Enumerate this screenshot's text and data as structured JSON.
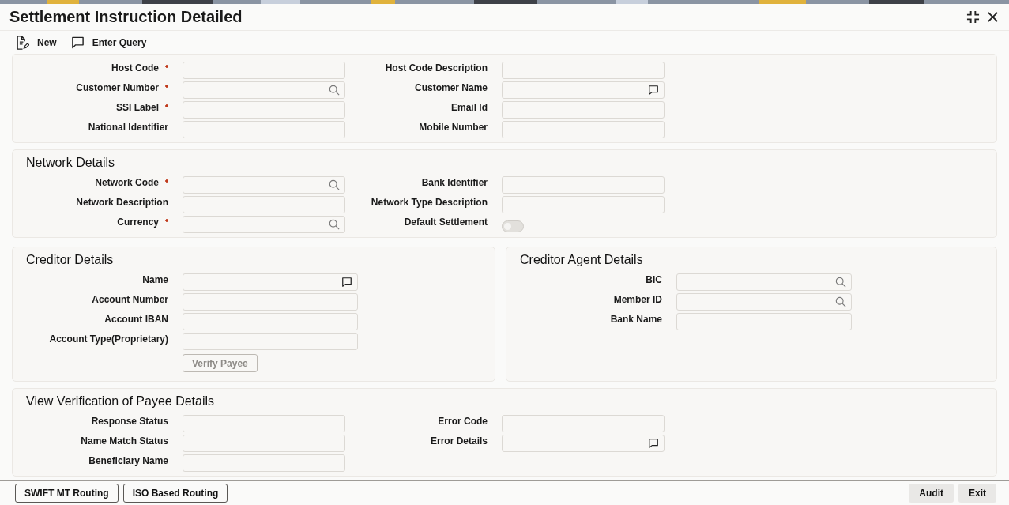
{
  "window": {
    "title": "Settlement Instruction Detailed"
  },
  "toolbar": [
    {
      "label": "New",
      "kind": "new"
    },
    {
      "label": "Enter Query",
      "kind": "query"
    }
  ],
  "sections": [
    {
      "wide": false,
      "columns": [
        {
          "fields": [
            {
              "label": "Host Code",
              "required": true,
              "kind": "plain"
            },
            {
              "label": "Customer Number",
              "required": true,
              "kind": "search"
            },
            {
              "label": "SSI Label",
              "required": true,
              "kind": "plain"
            },
            {
              "label": "National Identifier",
              "required": false,
              "kind": "plain"
            }
          ]
        },
        {
          "fields": [
            {
              "label": "Host Code Description",
              "required": false,
              "kind": "plain"
            },
            {
              "label": "Customer Name",
              "required": false,
              "kind": "comment"
            },
            {
              "label": "Email Id",
              "required": false,
              "kind": "plain"
            },
            {
              "label": "Mobile Number",
              "required": false,
              "kind": "plain"
            }
          ]
        }
      ]
    },
    {
      "title": "Network Details",
      "wide": false,
      "columns": [
        {
          "fields": [
            {
              "label": "Network Code",
              "required": true,
              "kind": "search"
            },
            {
              "label": "Network Description",
              "required": false,
              "kind": "plain"
            },
            {
              "label": "Currency",
              "required": true,
              "kind": "search"
            }
          ]
        },
        {
          "fields": [
            {
              "label": "Bank Identifier",
              "required": false,
              "kind": "plain"
            },
            {
              "label": "Network Type Description",
              "required": false,
              "kind": "plain"
            },
            {
              "label": "Default Settlement",
              "required": false,
              "kind": "toggle",
              "on": false
            }
          ]
        }
      ]
    },
    {
      "title": "Creditor Details",
      "wide": true,
      "columns": [
        {
          "fields": [
            {
              "label": "Name",
              "required": false,
              "kind": "comment"
            },
            {
              "label": "Account Number",
              "required": false,
              "kind": "plain"
            },
            {
              "label": "Account IBAN",
              "required": false,
              "kind": "plain"
            },
            {
              "label": "Account Type(Proprietary)",
              "required": false,
              "kind": "plain"
            },
            {
              "label": "Verify Payee",
              "kind": "button",
              "disabled": true
            }
          ]
        }
      ]
    },
    {
      "title": "Creditor Agent Details",
      "wide": true,
      "columns": [
        {
          "fields": [
            {
              "label": "BIC",
              "required": false,
              "kind": "search"
            },
            {
              "label": "Member ID",
              "required": false,
              "kind": "search"
            },
            {
              "label": "Bank Name",
              "required": false,
              "kind": "plain"
            }
          ]
        }
      ]
    },
    {
      "title": "View Verification of Payee Details",
      "wide": false,
      "columns": [
        {
          "fields": [
            {
              "label": "Response Status",
              "required": false,
              "kind": "plain"
            },
            {
              "label": "Name Match Status",
              "required": false,
              "kind": "plain"
            },
            {
              "label": "Beneficiary Name",
              "required": false,
              "kind": "plain"
            }
          ]
        },
        {
          "fields": [
            {
              "label": "Error Code",
              "required": false,
              "kind": "plain"
            },
            {
              "label": "Error Details",
              "required": false,
              "kind": "comment"
            }
          ]
        }
      ]
    }
  ],
  "footer": {
    "left": [
      {
        "label": "SWIFT MT Routing"
      },
      {
        "label": "ISO Based Routing"
      }
    ],
    "right": [
      {
        "label": "Audit"
      },
      {
        "label": "Exit"
      }
    ]
  }
}
